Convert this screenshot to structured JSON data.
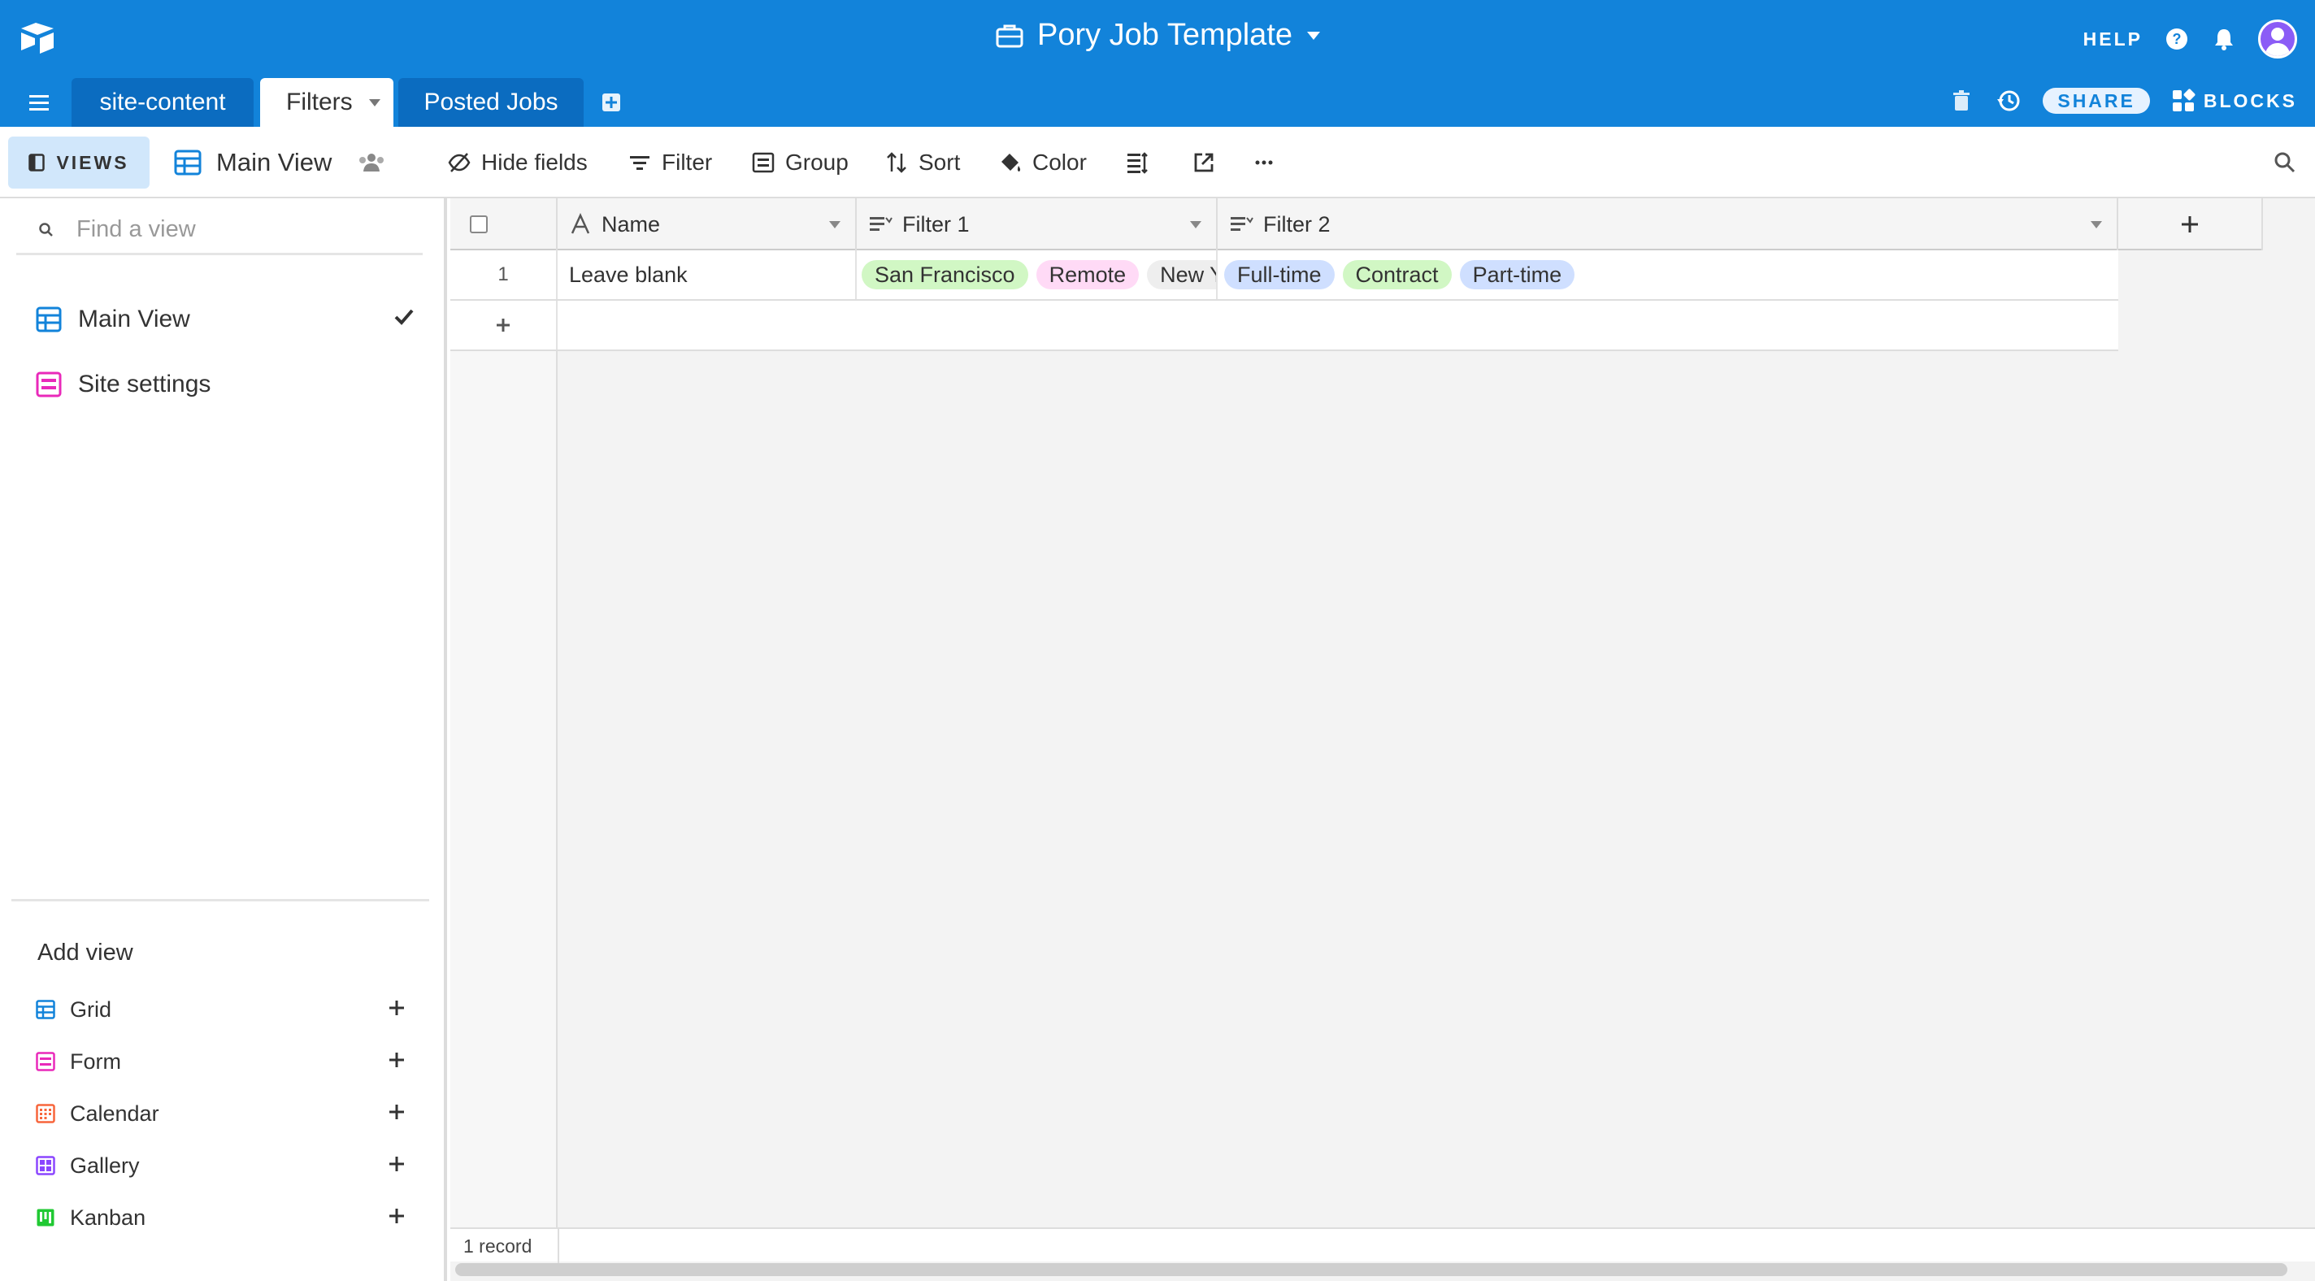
{
  "header": {
    "base_title": "Pory Job Template",
    "help_label": "HELP"
  },
  "tabs": {
    "items": [
      "site-content",
      "Filters",
      "Posted Jobs"
    ],
    "active": "Filters"
  },
  "tab_actions": {
    "share_label": "SHARE",
    "blocks_label": "BLOCKS"
  },
  "toolbar": {
    "views_label": "VIEWS",
    "current_view": "Main View",
    "hide_fields": "Hide fields",
    "filter": "Filter",
    "group": "Group",
    "sort": "Sort",
    "color": "Color"
  },
  "sidebar": {
    "search_placeholder": "Find a view",
    "views": [
      {
        "label": "Main View",
        "icon": "grid-icon",
        "selected": true
      },
      {
        "label": "Site settings",
        "icon": "form-icon",
        "selected": false
      }
    ],
    "add_view_title": "Add view",
    "add_view_items": [
      {
        "label": "Grid",
        "icon": "grid-icon",
        "color": "#1283da"
      },
      {
        "label": "Form",
        "icon": "form-icon",
        "color": "#e929ba"
      },
      {
        "label": "Calendar",
        "icon": "calendar-icon",
        "color": "#f7653b"
      },
      {
        "label": "Gallery",
        "icon": "gallery-icon",
        "color": "#8b46ff"
      },
      {
        "label": "Kanban",
        "icon": "kanban-icon",
        "color": "#20c933"
      }
    ]
  },
  "grid": {
    "columns": [
      {
        "label": "Name",
        "icon": "text-field-icon"
      },
      {
        "label": "Filter 1",
        "icon": "multiselect-icon"
      },
      {
        "label": "Filter 2",
        "icon": "multiselect-icon"
      }
    ],
    "rows": [
      {
        "number": "1",
        "name": "Leave blank",
        "filter_1": [
          {
            "text": "San Francisco",
            "color": "#d1f7c4"
          },
          {
            "text": "Remote",
            "color": "#ffdaf6"
          },
          {
            "text": "New Y",
            "color": "#eeeeee"
          }
        ],
        "filter_2": [
          {
            "text": "Full-time",
            "color": "#cfdfff"
          },
          {
            "text": "Contract",
            "color": "#d1f7c4"
          },
          {
            "text": "Part-time",
            "color": "#cfdfff"
          }
        ]
      }
    ],
    "record_count": "1 record"
  },
  "colors": {
    "brand_blue": "#1283da",
    "active_tab_bg": "#ffffff"
  }
}
